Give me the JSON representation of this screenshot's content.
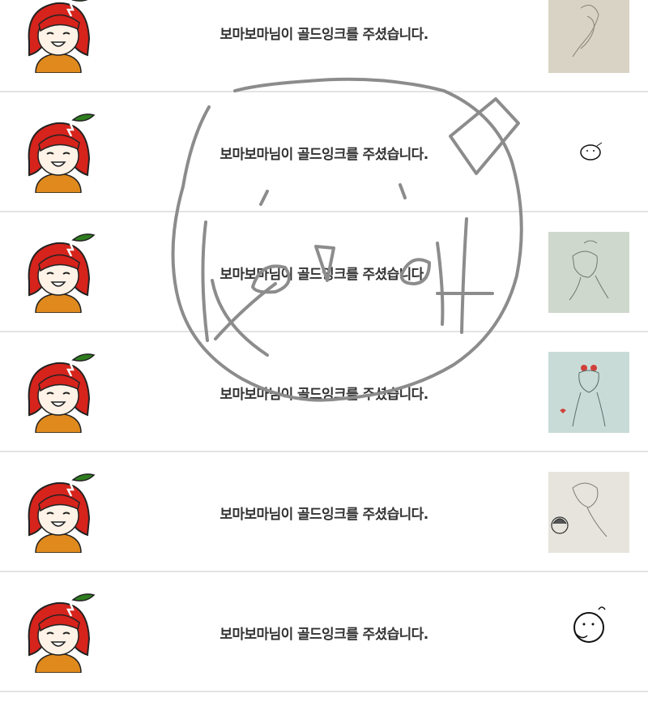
{
  "notifications": [
    {
      "message": "보마보마님이 골드잉크를 주셨습니다.",
      "avatar_icon": "red-hair-girl-avatar-icon",
      "thumbnail": "sketch-thumbnail"
    },
    {
      "message": "보마보마님이 골드잉크를 주셨습니다.",
      "avatar_icon": "red-hair-girl-avatar-icon",
      "thumbnail": "sketch-thumbnail"
    },
    {
      "message": "보마보마님이 골드잉크를 주셨습니다.",
      "avatar_icon": "red-hair-girl-avatar-icon",
      "thumbnail": "sketch-thumbnail"
    },
    {
      "message": "보마보마님이 골드잉크를 주셨습니다.",
      "avatar_icon": "red-hair-girl-avatar-icon",
      "thumbnail": "sketch-thumbnail"
    },
    {
      "message": "보마보마님이 골드잉크를 주셨습니다.",
      "avatar_icon": "red-hair-girl-avatar-icon",
      "thumbnail": "sketch-thumbnail"
    },
    {
      "message": "보마보마님이 골드잉크를 주셨습니다.",
      "avatar_icon": "red-hair-girl-avatar-icon",
      "thumbnail": "sketch-thumbnail"
    }
  ],
  "colors": {
    "divider": "#e3e3e3",
    "text": "#333333",
    "hair": "#d6231c",
    "leaf": "#2e7d1f",
    "shirt": "#e0891c",
    "overlay_stroke": "#8c8c8c"
  }
}
